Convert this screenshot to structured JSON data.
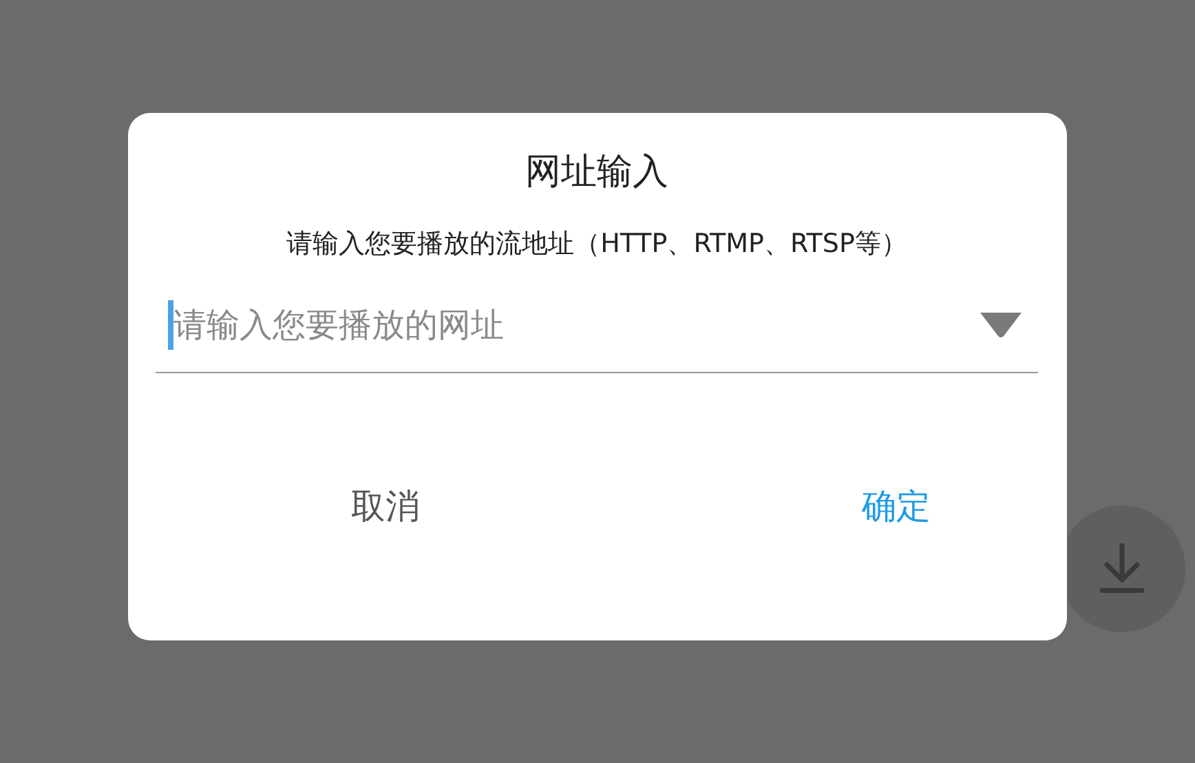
{
  "dialog": {
    "title": "网址输入",
    "message": "请输入您要播放的流地址（HTTP、RTMP、RTSP等）",
    "input": {
      "placeholder": "请输入您要播放的网址",
      "focused": true
    },
    "buttons": [
      {
        "label": "取消",
        "kind": "cancel"
      },
      {
        "label": "确定",
        "kind": "confirm"
      }
    ]
  },
  "fab": {
    "kind": "download"
  }
}
